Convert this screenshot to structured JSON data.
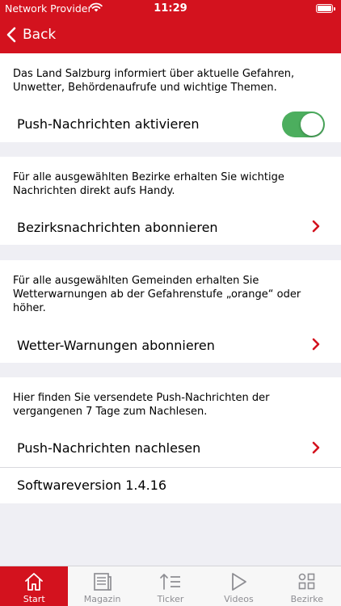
{
  "status_bar": {
    "carrier": "Network Provider",
    "time": "11:29"
  },
  "header": {
    "back_label": "Back",
    "background_color": "#d3121e"
  },
  "sections": {
    "push": {
      "description": "Das Land Salzburg informiert über aktuelle Gefahren, Unwetter, Behördenaufrufe und wichtige Themen.",
      "toggle_label": "Push-Nachrichten aktivieren",
      "toggle_on": true,
      "toggle_color": "#4cae5e"
    },
    "bezirke": {
      "description": "Für alle ausgewählten Bezirke erhalten Sie wichtige Nachrichten direkt aufs Handy.",
      "row_label": "Bezirksnachrichten abonnieren"
    },
    "wetter": {
      "description": "Für alle ausgewählten Gemeinden erhalten Sie Wetterwarnungen ab der Gefahrenstufe „orange“ oder höher.",
      "row_label": "Wetter-Warnungen abonnieren"
    },
    "archive": {
      "description": "Hier finden Sie versendete Push-Nachrichten der vergangenen 7 Tage zum Nachlesen.",
      "row_label": "Push-Nachrichten nachlesen"
    },
    "version": {
      "label": "Softwareversion 1.4.16"
    }
  },
  "tabbar": {
    "tabs": [
      {
        "label": "Start",
        "icon": "home-icon",
        "active": true
      },
      {
        "label": "Magazin",
        "icon": "magazine-icon",
        "active": false
      },
      {
        "label": "Ticker",
        "icon": "ticker-icon",
        "active": false
      },
      {
        "label": "Videos",
        "icon": "play-icon",
        "active": false
      },
      {
        "label": "Bezirke",
        "icon": "grid-icon",
        "active": false
      }
    ]
  }
}
